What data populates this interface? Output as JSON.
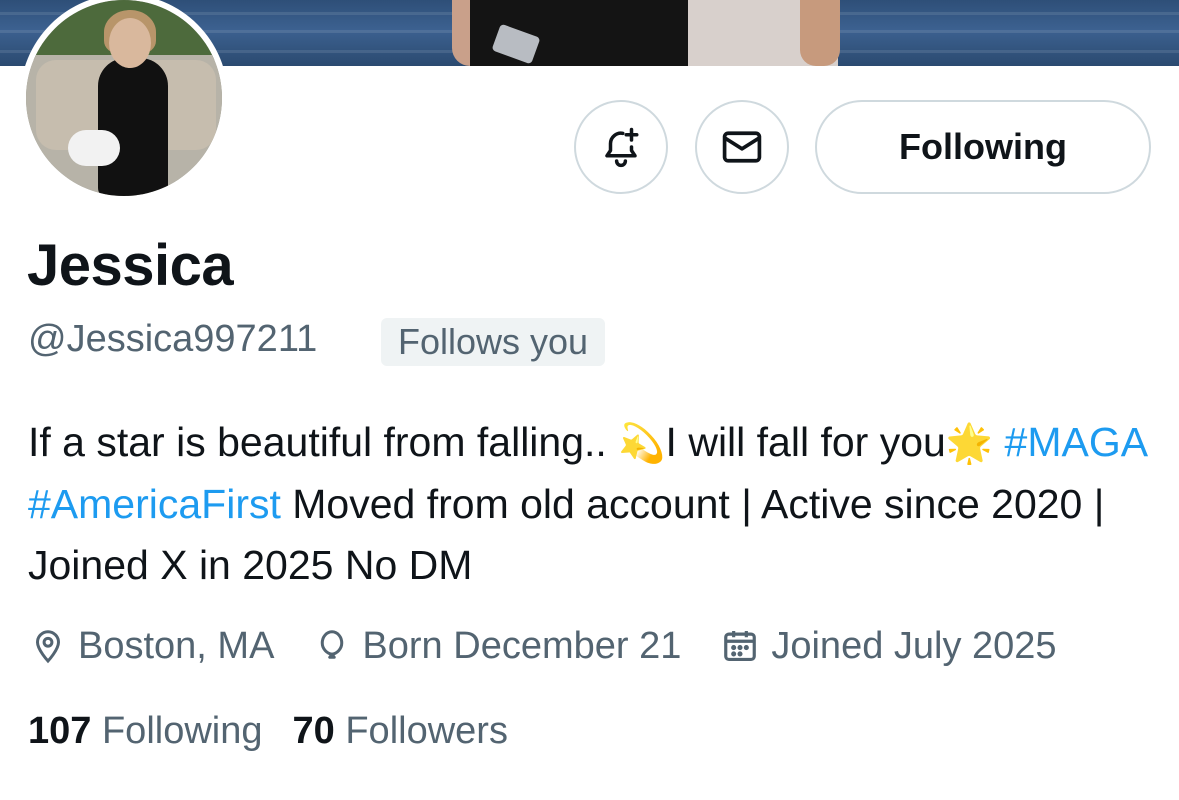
{
  "profile": {
    "display_name": "Jessica",
    "handle": "@Jessica997211",
    "follows_you_badge": "Follows you"
  },
  "actions": {
    "notify_icon": "bell-plus-icon",
    "message_icon": "envelope-icon",
    "follow_label": "Following"
  },
  "bio": {
    "line_start": "If a star is beautiful from falling..",
    "emoji1": "💫",
    "line_mid": "I will fall for you",
    "emoji2": "🌟",
    "hashtag1": "#MAGA",
    "hashtag2": "#AmericaFirst",
    "rest": "Moved from old account | Active since 2020 | Joined X in 2025 No DM"
  },
  "meta": {
    "location": "Boston, MA",
    "location_icon": "location-pin-icon",
    "birthday": "Born December 21",
    "birthday_icon": "balloon-icon",
    "joined": "Joined July 2025",
    "joined_icon": "calendar-icon"
  },
  "stats": {
    "following_count": "107",
    "following_label": "Following",
    "followers_count": "70",
    "followers_label": "Followers"
  },
  "colors": {
    "text": "#0f1419",
    "secondary": "#536471",
    "link": "#1d9bf0",
    "border": "#cfd9de",
    "badge_bg": "#eff3f4"
  }
}
